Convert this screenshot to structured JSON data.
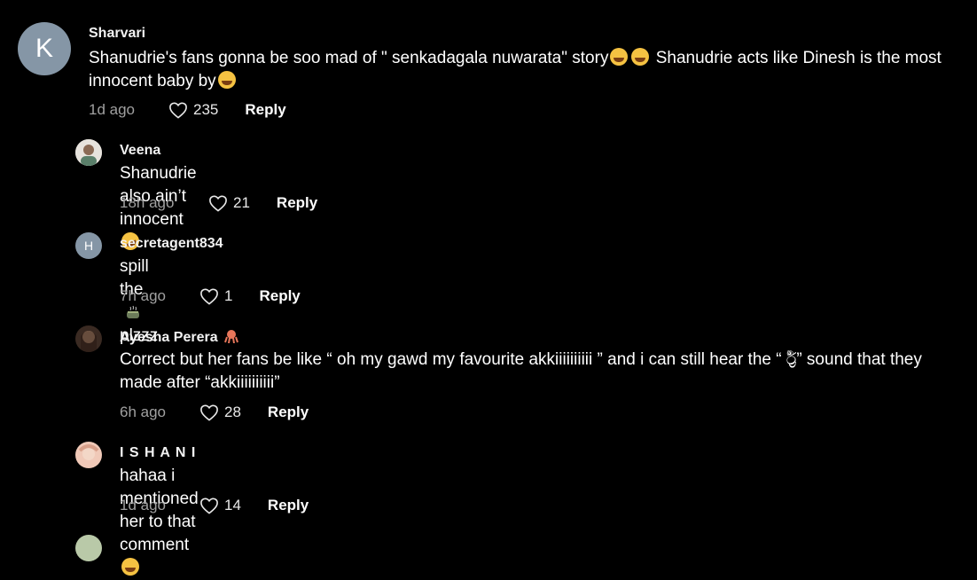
{
  "comments": [
    {
      "username": "Sharvari",
      "avatar_letter": "K",
      "text_a": "Shanudrie's fans gonna be soo mad of \" senkadagala nuwarata\" story",
      "text_b": " Shanudrie acts like Dinesh is the most innocent baby by",
      "time": "1d ago",
      "likes": "235",
      "reply": "Reply"
    },
    {
      "username": "Veena",
      "text_a": "Shanudrie also ain’t innocent",
      "time": "18h ago",
      "likes": "21",
      "reply": "Reply"
    },
    {
      "username": "secretagent834",
      "avatar_letter": "H",
      "text_a": "spill the",
      "text_b": "plzzz",
      "time": "7h ago",
      "likes": "1",
      "reply": "Reply"
    },
    {
      "username": "Ayesha Perera",
      "text_a": "Correct but her fans be like “ oh my gawd my favourite akkiiiiiiiiii ” and i can still hear the “ ර්‍ර්‍ර්‍ර්‍ර්‍” sound that they made after “akkiiiiiiiiii”",
      "time": "6h ago",
      "likes": "28",
      "reply": "Reply"
    },
    {
      "username": "I S H A N I",
      "text_a": "hahaa i mentioned her to that comment",
      "time": "1d ago",
      "likes": "14",
      "reply": "Reply"
    }
  ],
  "colors": {
    "background": "#000000",
    "avatar": "#8596a6",
    "secondary_text": "#a0a0a0"
  },
  "icons": [
    "heart-outline-icon",
    "laughing-emoji-icon",
    "tea-cup-emoji-icon",
    "octopus-emoji-icon",
    "rolling-laugh-emoji-icon"
  ]
}
